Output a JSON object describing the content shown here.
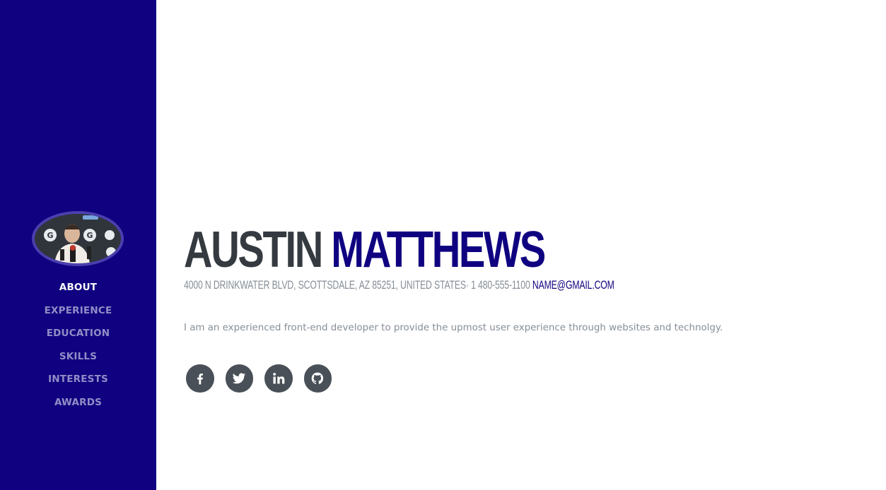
{
  "sidebar": {
    "avatar_alt": "profile photo",
    "nav": [
      {
        "label": "About",
        "active": true
      },
      {
        "label": "Experience",
        "active": false
      },
      {
        "label": "Education",
        "active": false
      },
      {
        "label": "Skills",
        "active": false
      },
      {
        "label": "Interests",
        "active": false
      },
      {
        "label": "Awards",
        "active": false
      }
    ]
  },
  "about": {
    "first_name": "Austin",
    "last_name": "Matthews",
    "address": "4000 N DRINKWATER BLVD, SCOTTSDALE, AZ 85251, UNITED STATES· 1 480-555-1100",
    "email": "NAME@GMAIL.COM",
    "lead": "I am an experienced front-end developer to provide the upmost user experience through websites and technolgy."
  },
  "social": [
    {
      "icon": "facebook-icon"
    },
    {
      "icon": "twitter-icon"
    },
    {
      "icon": "linkedin-icon"
    },
    {
      "icon": "github-icon"
    }
  ],
  "colors": {
    "primary": "#0f0180",
    "name_dark": "#343a40",
    "muted": "#868e96",
    "social_bg": "#495057"
  }
}
